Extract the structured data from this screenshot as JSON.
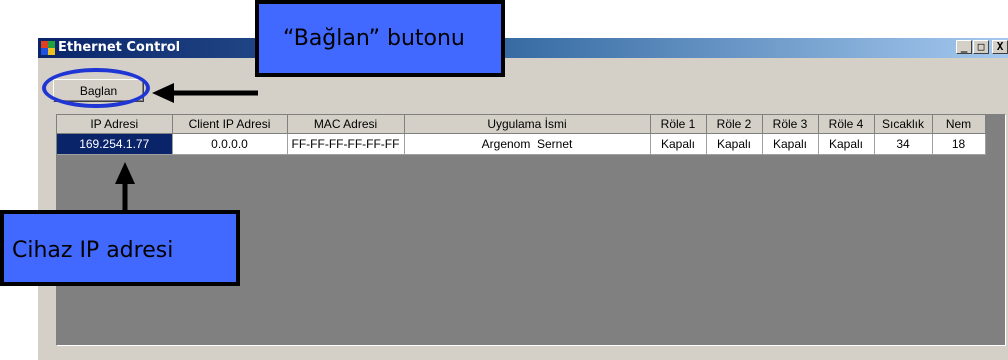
{
  "window": {
    "title": "Ethernet Control",
    "controls": [
      "_",
      "□",
      "X"
    ]
  },
  "toolbar": {
    "connect_label": "Baglan"
  },
  "grid": {
    "columns": [
      "IP Adresi",
      "Client IP Adresi",
      "MAC Adresi",
      "Uygulama İsmi",
      "Röle 1",
      "Röle 2",
      "Röle 3",
      "Röle 4",
      "Sıcaklık",
      "Nem"
    ],
    "rows": [
      [
        "169.254.1.77",
        "0.0.0.0",
        "FF-FF-FF-FF-FF-FF",
        "Argenom  Sernet",
        "Kapalı",
        "Kapalı",
        "Kapalı",
        "Kapalı",
        "34",
        "18"
      ]
    ]
  },
  "annotations": {
    "connect_button_caption": "“Bağlan” butonu",
    "device_ip_caption": "Cihaz IP adresi"
  },
  "colors": {
    "callout_fill": "#4169ff",
    "ellipse_stroke": "#1f35d4",
    "selection": "#0a246a"
  }
}
